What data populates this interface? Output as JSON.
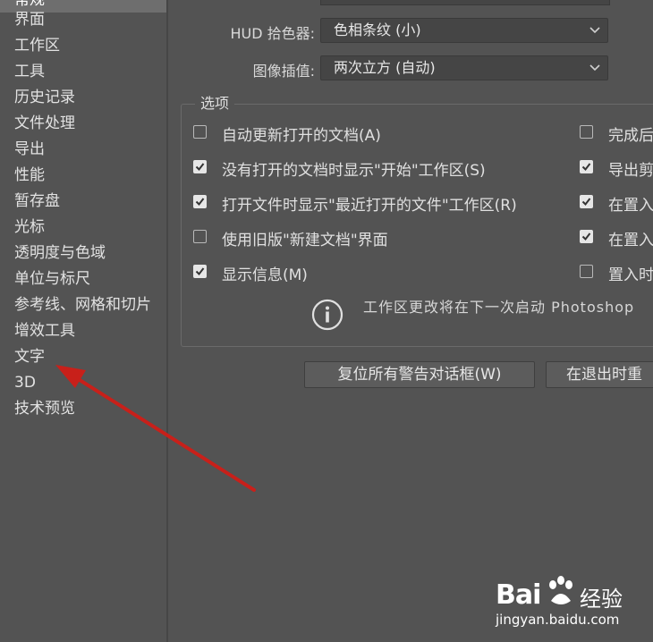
{
  "sidebar": {
    "items": [
      {
        "label": "常规"
      },
      {
        "label": "界面"
      },
      {
        "label": "工作区"
      },
      {
        "label": "工具"
      },
      {
        "label": "历史记录"
      },
      {
        "label": "文件处理"
      },
      {
        "label": "导出"
      },
      {
        "label": "性能"
      },
      {
        "label": "暂存盘"
      },
      {
        "label": "光标"
      },
      {
        "label": "透明度与色域"
      },
      {
        "label": "单位与标尺"
      },
      {
        "label": "参考线、网格和切片"
      },
      {
        "label": "增效工具"
      },
      {
        "label": "文字"
      },
      {
        "label": "3D"
      },
      {
        "label": "技术预览"
      }
    ]
  },
  "form": {
    "hud_label": "HUD 拾色器:",
    "hud_value": "色相条纹 (小)",
    "interp_label": "图像插值:",
    "interp_value": "两次立方 (自动)"
  },
  "options": {
    "legend": "选项",
    "left": [
      {
        "label": "自动更新打开的文档(A)",
        "checked": false
      },
      {
        "label": "没有打开的文档时显示\"开始\"工作区(S)",
        "checked": true
      },
      {
        "label": "打开文件时显示\"最近打开的文件\"工作区(R)",
        "checked": true
      },
      {
        "label": "使用旧版\"新建文档\"界面",
        "checked": false
      },
      {
        "label": "显示信息(M)",
        "checked": true
      }
    ],
    "right": [
      {
        "label": "完成后",
        "checked": false
      },
      {
        "label": "导出剪",
        "checked": true
      },
      {
        "label": "在置入",
        "checked": true
      },
      {
        "label": "在置入",
        "checked": true
      },
      {
        "label": "置入时",
        "checked": false
      }
    ],
    "info_text": "工作区更改将在下一次启动 Photoshop"
  },
  "buttons": {
    "reset_warnings": "复位所有警告对话框(W)",
    "reset_on_exit": "在退出时重"
  },
  "watermark": {
    "brand": "Bai",
    "brand_tail": "经验",
    "url": "jingyan.baidu.com"
  }
}
